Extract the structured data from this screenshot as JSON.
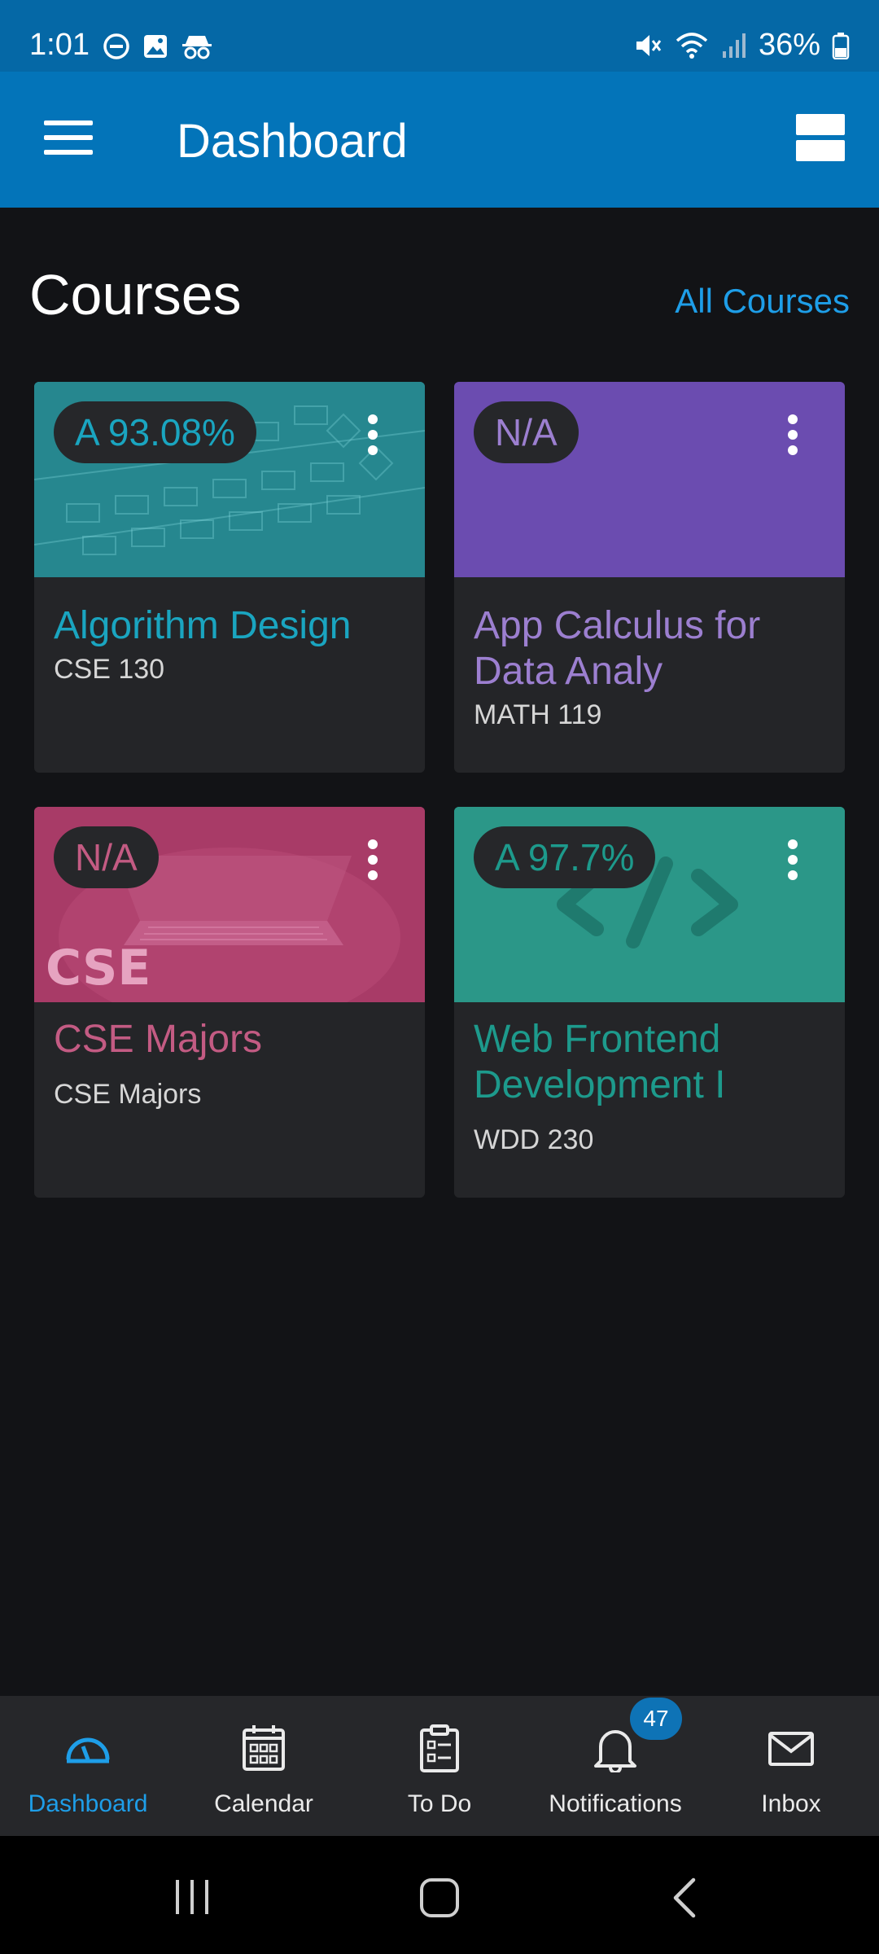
{
  "status": {
    "time": "1:01",
    "battery": "36%"
  },
  "appbar": {
    "title": "Dashboard"
  },
  "courses_section": {
    "title": "Courses",
    "all_link": "All Courses"
  },
  "courses": [
    {
      "grade": "A 93.08%",
      "name": "Algorithm Design",
      "code": "CSE 130",
      "color": "#1aa5c0"
    },
    {
      "grade": "N/A",
      "name": "App Calculus for Data Analy",
      "code": "MATH 119",
      "color": "#9c7fd0"
    },
    {
      "grade": "N/A",
      "name": "CSE Majors",
      "code": "CSE Majors",
      "color": "#c35b83",
      "banner_text": "CSE"
    },
    {
      "grade": "A 97.7%",
      "name": "Web Frontend Development I",
      "code": "WDD 230",
      "color": "#1d9a8c"
    }
  ],
  "bottom_nav": {
    "items": [
      {
        "label": "Dashboard",
        "icon": "dashboard-icon"
      },
      {
        "label": "Calendar",
        "icon": "calendar-icon"
      },
      {
        "label": "To Do",
        "icon": "clipboard-icon"
      },
      {
        "label": "Notifications",
        "icon": "bell-icon"
      },
      {
        "label": "Inbox",
        "icon": "mail-icon"
      }
    ],
    "notifications_badge": "47",
    "active_color": "#1e9ee8"
  }
}
